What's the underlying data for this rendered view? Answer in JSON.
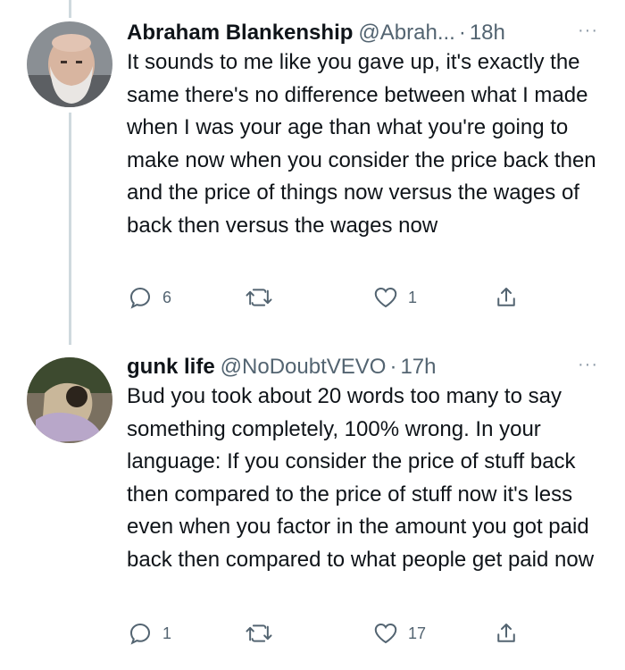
{
  "tweets": [
    {
      "name": "Abraham Blankenship",
      "handle": "@Abrah...",
      "separator": "·",
      "time": "18h",
      "more": "···",
      "text": "It sounds to me like  you  gave up, it's exactly the same there's no difference between what I made when I was your age than what you're going to make now when you consider the price back then and the price of things now versus the wages of back then versus the wages now",
      "replies": "6",
      "retweets": "",
      "likes": "1"
    },
    {
      "name": "gunk life",
      "handle": "@NoDoubtVEVO",
      "separator": "·",
      "time": "17h",
      "more": "···",
      "text": "Bud you took about 20 words too many to say something completely, 100% wrong. In your language: If you consider the price of stuff back then compared to the price of stuff now it's less even when you factor in the amount you got paid back then compared to what people get paid now",
      "replies": "1",
      "retweets": "",
      "likes": "17"
    }
  ],
  "icons": {
    "reply": "reply-icon",
    "retweet": "retweet-icon",
    "like": "heart-icon",
    "share": "share-icon"
  },
  "colors": {
    "secondary_text": "#536471",
    "thread_line": "#cfd9de"
  }
}
